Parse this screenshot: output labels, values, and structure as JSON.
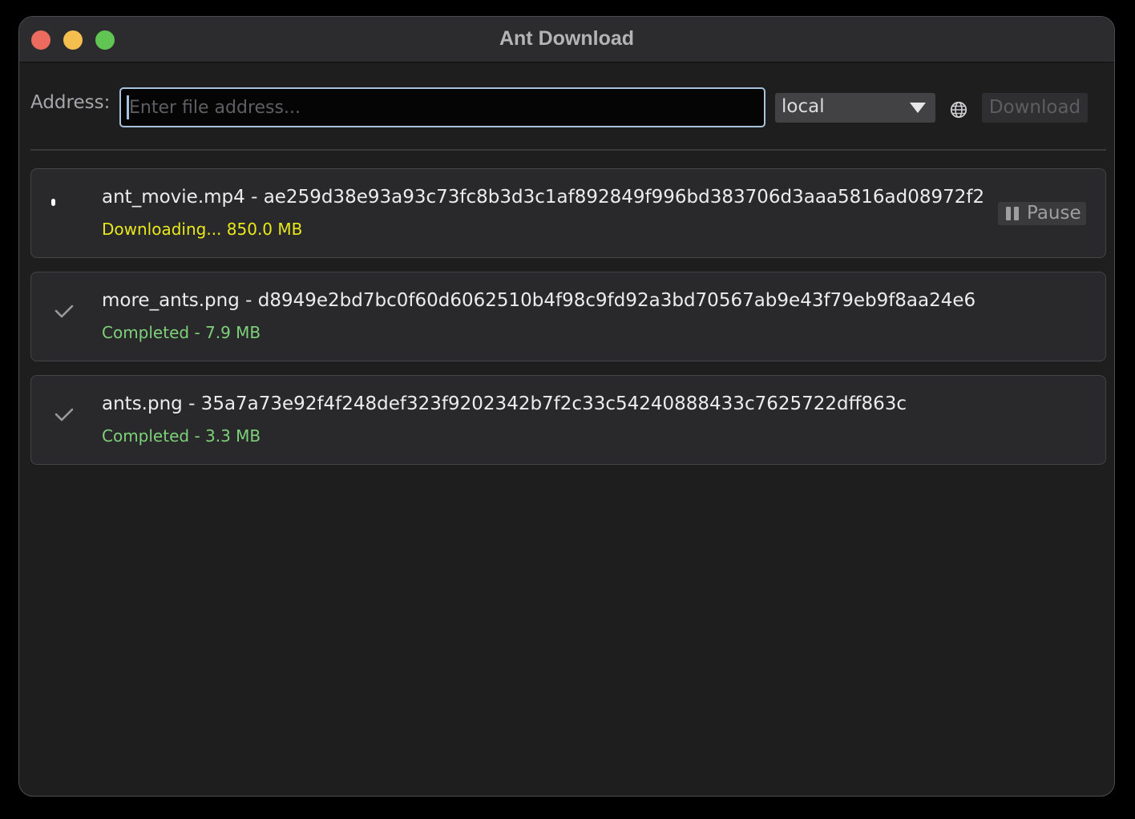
{
  "window": {
    "title": "Ant Download"
  },
  "toolbar": {
    "address_label": "Address:",
    "address_value": "",
    "address_placeholder": "Enter file address...",
    "network_selected": "local",
    "globe_icon": "globe-icon",
    "download_label": "Download"
  },
  "downloads": [
    {
      "name": "ant_movie.mp4 - ae259d38e93a93c73fc8b3d3c1af892849f996bd383706d3aaa5816ad08972f2",
      "status": "Downloading... 850.0 MB",
      "state": "downloading",
      "icon": "spinner-icon",
      "action_label": "Pause",
      "action_icon": "pause-icon"
    },
    {
      "name": "more_ants.png - d8949e2bd7bc0f60d6062510b4f98c9fd92a3bd70567ab9e43f79eb9f8aa24e6",
      "status": "Completed - 7.9 MB",
      "state": "completed",
      "icon": "checkmark-icon"
    },
    {
      "name": "ants.png - 35a7a73e92f4f248def323f9202342b7f2c33c54240888433c7625722dff863c",
      "status": "Completed - 3.3 MB",
      "state": "completed",
      "icon": "checkmark-icon"
    }
  ],
  "colors": {
    "downloading": "#e8e81c",
    "completed": "#7ed17a",
    "input_focus": "#a7c2dc"
  }
}
